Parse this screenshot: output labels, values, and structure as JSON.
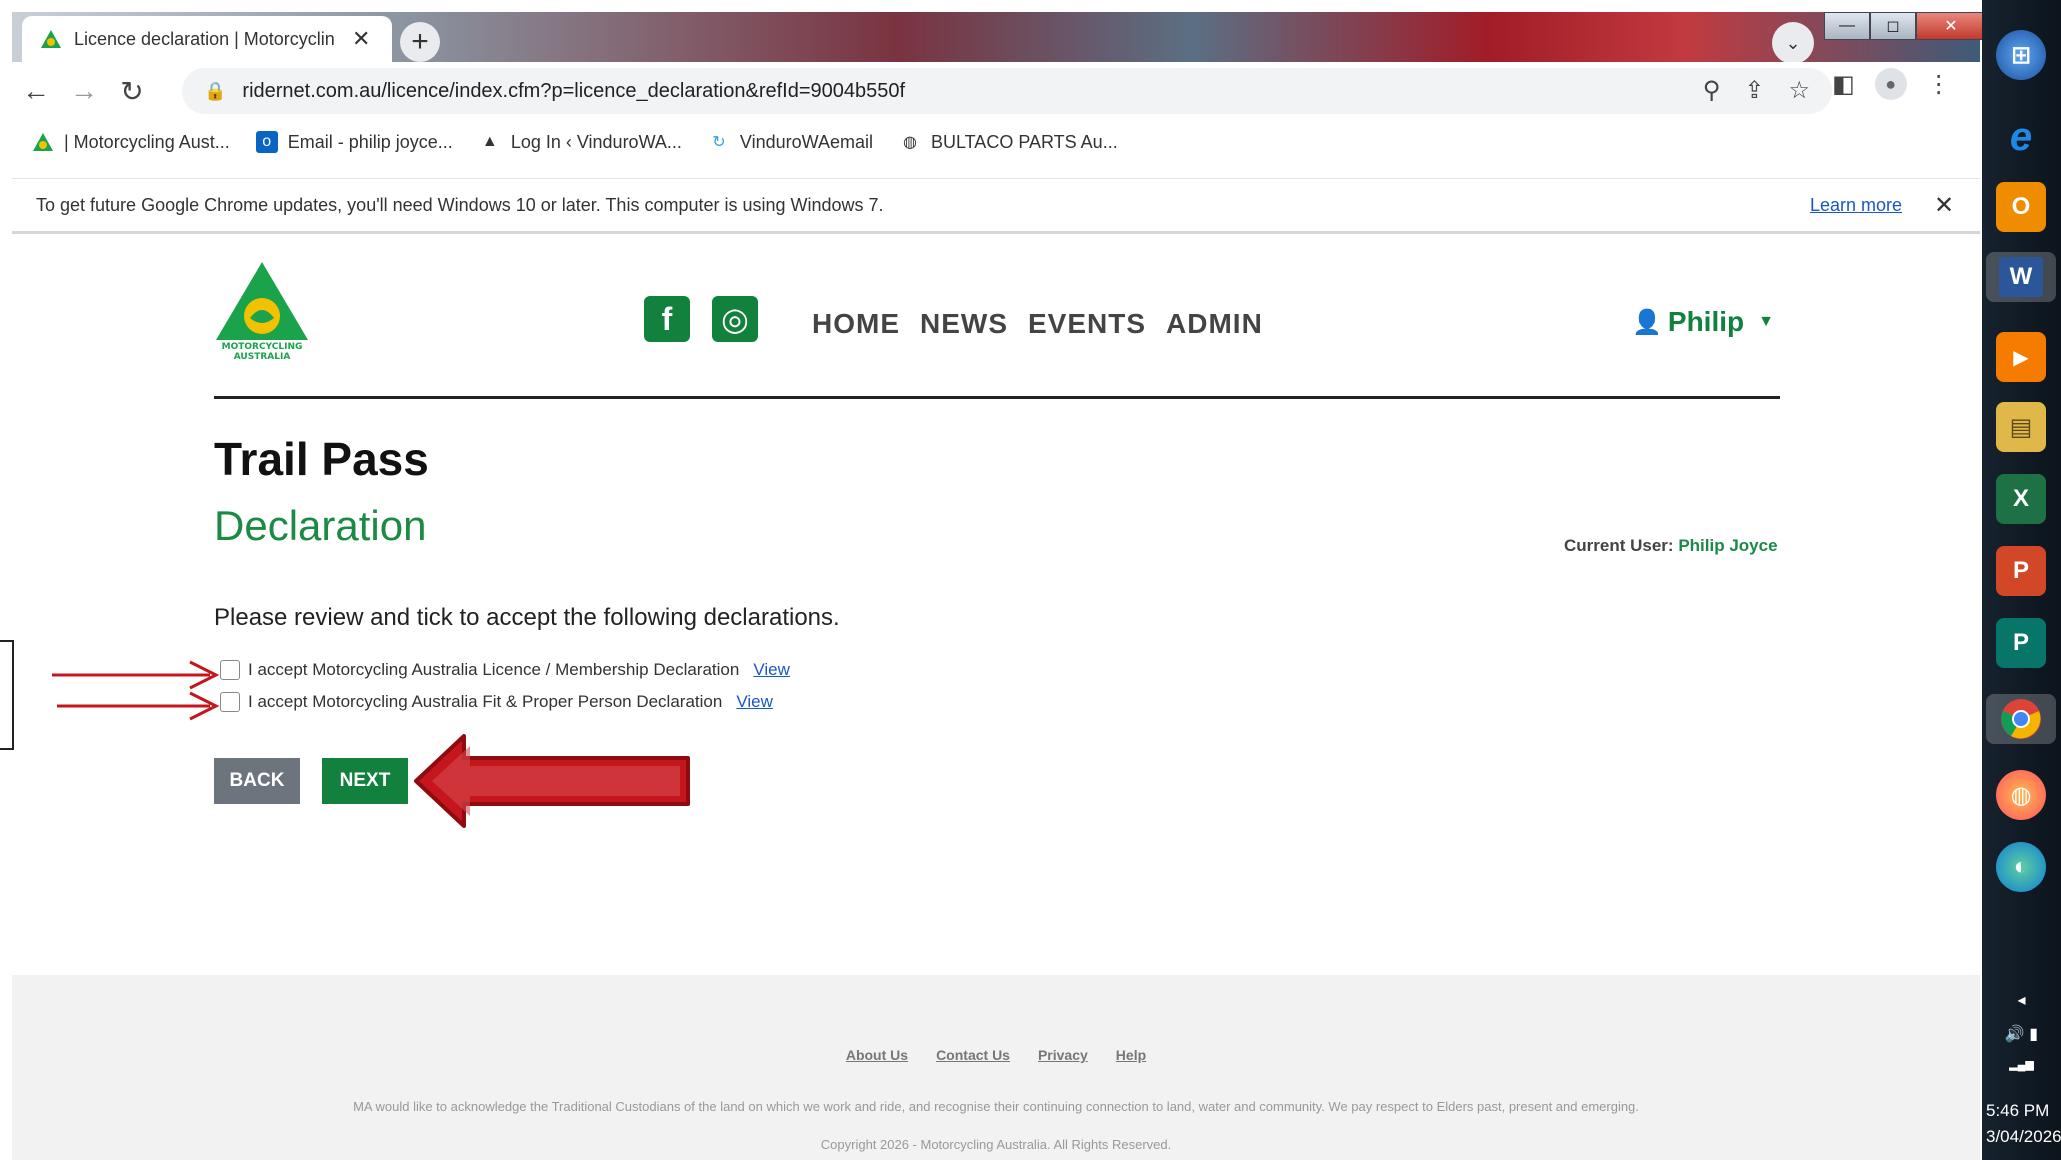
{
  "browser": {
    "tab": {
      "title": "Licence declaration | Motorcyclin",
      "close": "✕"
    },
    "new_tab": "+",
    "tab_search": "⌄",
    "window_controls": {
      "minimize": "—",
      "maximize": "◻",
      "close": "✕"
    },
    "nav": {
      "back": "←",
      "forward": "→",
      "reload": "↻"
    },
    "url": "ridernet.com.au/licence/index.cfm?p=licence_declaration&refId=9004b550f",
    "bookmarks": [
      {
        "label": "| Motorcycling Aust...",
        "icon": "ma-triangle-icon"
      },
      {
        "label": "Email - philip joyce...",
        "icon": "outlook-icon"
      },
      {
        "label": "Log In ‹ VinduroWA...",
        "icon": "mountain-icon"
      },
      {
        "label": "VinduroWAemail",
        "icon": "refresh-logo-icon"
      },
      {
        "label": "BULTACO PARTS Au...",
        "icon": "globe-icon"
      }
    ],
    "infobar": {
      "message": "To get future Google Chrome updates, you'll need Windows 10 or later. This computer is using Windows 7.",
      "learn_more": "Learn more",
      "close": "✕"
    }
  },
  "site": {
    "logo_text_line1": "MOTORCYCLING",
    "logo_text_line2": "AUSTRALIA",
    "nav": [
      "HOME",
      "NEWS",
      "EVENTS",
      "ADMIN"
    ],
    "user": "Philip",
    "user_icon": "👤",
    "caret": "▼",
    "social": {
      "facebook": "f",
      "instagram": "◎"
    }
  },
  "main": {
    "title": "Trail Pass",
    "subtitle": "Declaration",
    "current_user_label": "Current User:",
    "current_user_name": "Philip Joyce",
    "instructions": "Please review and tick to accept the following declarations.",
    "declarations": [
      {
        "label": "I accept Motorcycling Australia Licence / Membership Declaration",
        "link": "View",
        "checked": false
      },
      {
        "label": "I accept Motorcycling Australia Fit & Proper Person Declaration",
        "link": "View",
        "checked": false
      }
    ],
    "back_button": "BACK",
    "next_button": "NEXT"
  },
  "footer": {
    "links": [
      "About Us",
      "Contact Us",
      "Privacy",
      "Help"
    ],
    "acknowledgement": "MA would like to acknowledge the Traditional Custodians of the land on which we work and ride, and recognise their continuing connection to land, water and community. We pay respect to Elders past, present and emerging.",
    "copyright": "Copyright 2026 - Motorcycling Australia. All Rights Reserved."
  },
  "taskbar": {
    "apps": [
      {
        "name": "start-orb-icon",
        "glyph": "⊞",
        "color": "#3a7bd5"
      },
      {
        "name": "internet-explorer-icon",
        "glyph": "e",
        "color": "#1e88e5"
      },
      {
        "name": "outlook-icon",
        "glyph": "O",
        "color": "#f08c00"
      },
      {
        "name": "word-icon",
        "glyph": "W",
        "color": "#2b579a"
      },
      {
        "name": "media-player-icon",
        "glyph": "▶",
        "color": "#f57c00"
      },
      {
        "name": "file-explorer-icon",
        "glyph": "▤",
        "color": "#e0b84a"
      },
      {
        "name": "excel-icon",
        "glyph": "X",
        "color": "#1e7145"
      },
      {
        "name": "powerpoint-icon",
        "glyph": "P",
        "color": "#d24726"
      },
      {
        "name": "publisher-icon",
        "glyph": "P",
        "color": "#077568"
      },
      {
        "name": "chrome-icon",
        "glyph": "◉",
        "color": "#4caf50"
      },
      {
        "name": "firefox-icon",
        "glyph": "◍",
        "color": "#ff7139"
      },
      {
        "name": "edge-icon",
        "glyph": "◐",
        "color": "#0c7cd5"
      }
    ],
    "tray_arrow": "◂",
    "volume": "🔊",
    "battery": "▮",
    "signal": "▂▄▆",
    "time": "5:46 PM",
    "date": "3/04/2026"
  },
  "colors": {
    "brand_green": "#11813d",
    "heading_green": "#1a8a44",
    "annotation_red": "#c4161c"
  }
}
